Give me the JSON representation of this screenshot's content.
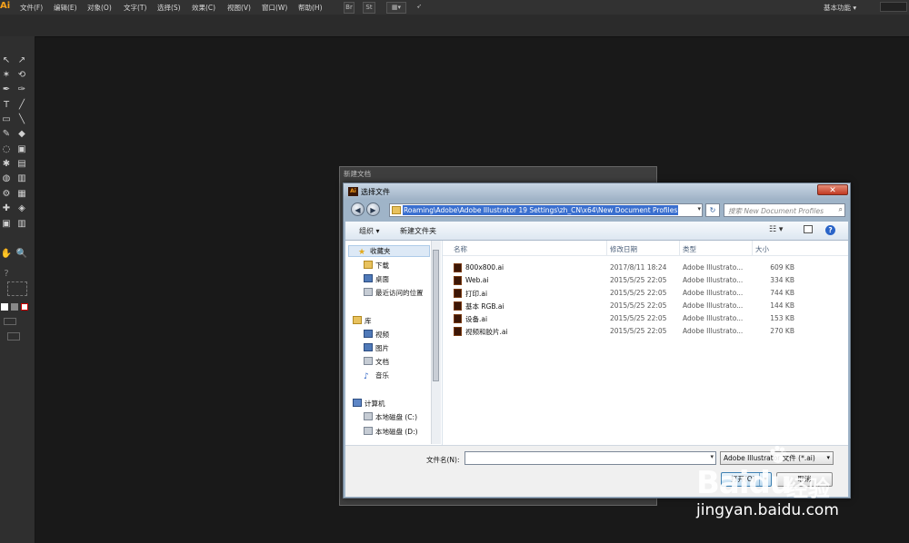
{
  "app": {
    "logo": "Ai",
    "menu": [
      "文件(F)",
      "编辑(E)",
      "对象(O)",
      "文字(T)",
      "选择(S)",
      "效果(C)",
      "视图(V)",
      "窗口(W)",
      "帮助(H)"
    ],
    "toolbar_buttons": [
      "Br",
      "St"
    ],
    "workspace": "基本功能",
    "workspace_arrow": "▾"
  },
  "tools": [
    "↖",
    "↗",
    "✶",
    "⟲",
    "✒",
    "✑",
    "T",
    "╱",
    "▭",
    "╲",
    "✎",
    "◆",
    "◌",
    "▣",
    "✱",
    "▤",
    "◍",
    "▥",
    "⚙",
    "▦",
    "✚",
    "◈",
    "▣",
    "▥",
    "✋",
    "🔍",
    "?",
    "▫"
  ],
  "outer_dialog": {
    "title": "新建文档"
  },
  "dialog": {
    "icon": "Ai",
    "title": "选择文件",
    "close": "✕",
    "back": "◀",
    "forward": "▶",
    "path": "Roaming\\Adobe\\Adobe Illustrator 19 Settings\\zh_CN\\x64\\New Document Profiles",
    "path_dropdown": "▾",
    "refresh": "↻",
    "search_placeholder": "搜索 New Document Profiles",
    "search_icon": "⌕",
    "organize": "组织 ▾",
    "new_folder": "新建文件夹",
    "view_icon": "☷ ▾",
    "help": "?"
  },
  "nav": {
    "favorites": "收藏夹",
    "downloads": "下载",
    "desktop": "桌面",
    "recent": "最近访问的位置",
    "libraries": "库",
    "videos": "视频",
    "pictures": "图片",
    "documents": "文档",
    "music": "音乐",
    "computer": "计算机",
    "disk_c": "本地磁盘 (C:)",
    "disk_d": "本地磁盘 (D:)"
  },
  "columns": {
    "name": "名称",
    "date": "修改日期",
    "type": "类型",
    "size": "大小"
  },
  "files": [
    {
      "name": "800x800.ai",
      "date": "2017/8/11 18:24",
      "type": "Adobe Illustrato...",
      "size": "609 KB"
    },
    {
      "name": "Web.ai",
      "date": "2015/5/25 22:05",
      "type": "Adobe Illustrato...",
      "size": "334 KB"
    },
    {
      "name": "打印.ai",
      "date": "2015/5/25 22:05",
      "type": "Adobe Illustrato...",
      "size": "744 KB"
    },
    {
      "name": "基本 RGB.ai",
      "date": "2015/5/25 22:05",
      "type": "Adobe Illustrato...",
      "size": "144 KB"
    },
    {
      "name": "设备.ai",
      "date": "2015/5/25 22:05",
      "type": "Adobe Illustrato...",
      "size": "153 KB"
    },
    {
      "name": "视频和胶片.ai",
      "date": "2015/5/25 22:05",
      "type": "Adobe Illustrato...",
      "size": "270 KB"
    }
  ],
  "bottom": {
    "filename_label": "文件名(N):",
    "filename_value": "",
    "filetype": "Adobe Illustrator 文件 (*.ai)",
    "open": "打开(O)",
    "cancel": "取消"
  },
  "watermark": {
    "brand": "Baidu",
    "sub": "经验",
    "url": "jingyan.baidu.com"
  }
}
